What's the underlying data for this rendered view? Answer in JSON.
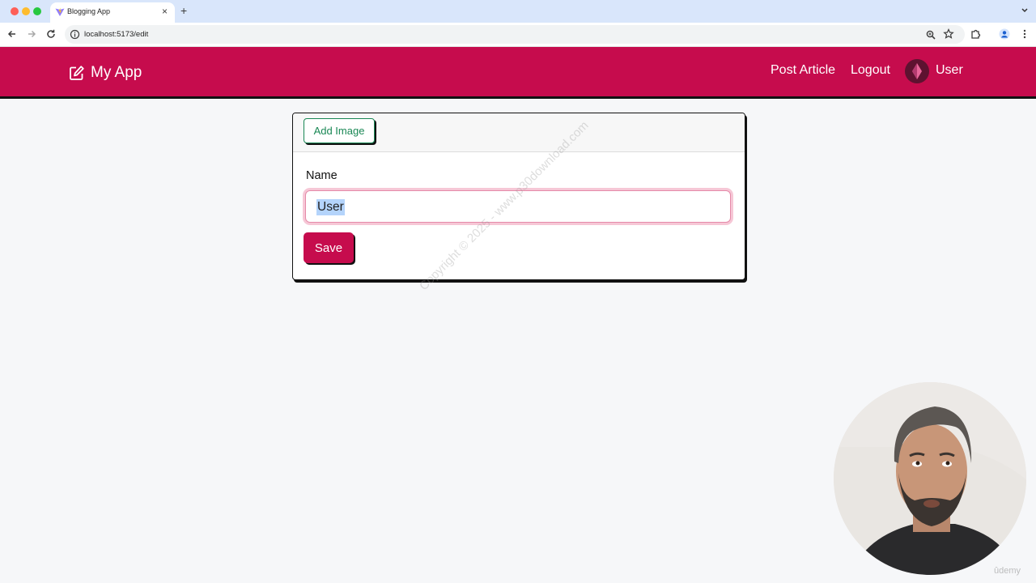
{
  "browser": {
    "tab": {
      "title": "Blogging App",
      "close_glyph": "×"
    },
    "newtab_glyph": "+",
    "url": "localhost:5173/edit"
  },
  "navbar": {
    "brand": "My App",
    "links": {
      "post_article": "Post Article",
      "logout": "Logout",
      "user": "User"
    }
  },
  "editor": {
    "add_image_label": "Add Image",
    "name_label": "Name",
    "name_value": "User",
    "save_label": "Save"
  },
  "watermark": "Copyright © 2025 - www.p30download.com",
  "branding": "ûdemy",
  "colors": {
    "primary": "#c60c4d",
    "success": "#198754",
    "page_bg": "#f6f7f9",
    "tabstrip_bg": "#d9e6fb",
    "selection": "#b4d4fb"
  },
  "icons": {
    "brand": "edit-icon",
    "avatar": "avatar-gem-icon",
    "tab_favicon": "vite-icon"
  }
}
